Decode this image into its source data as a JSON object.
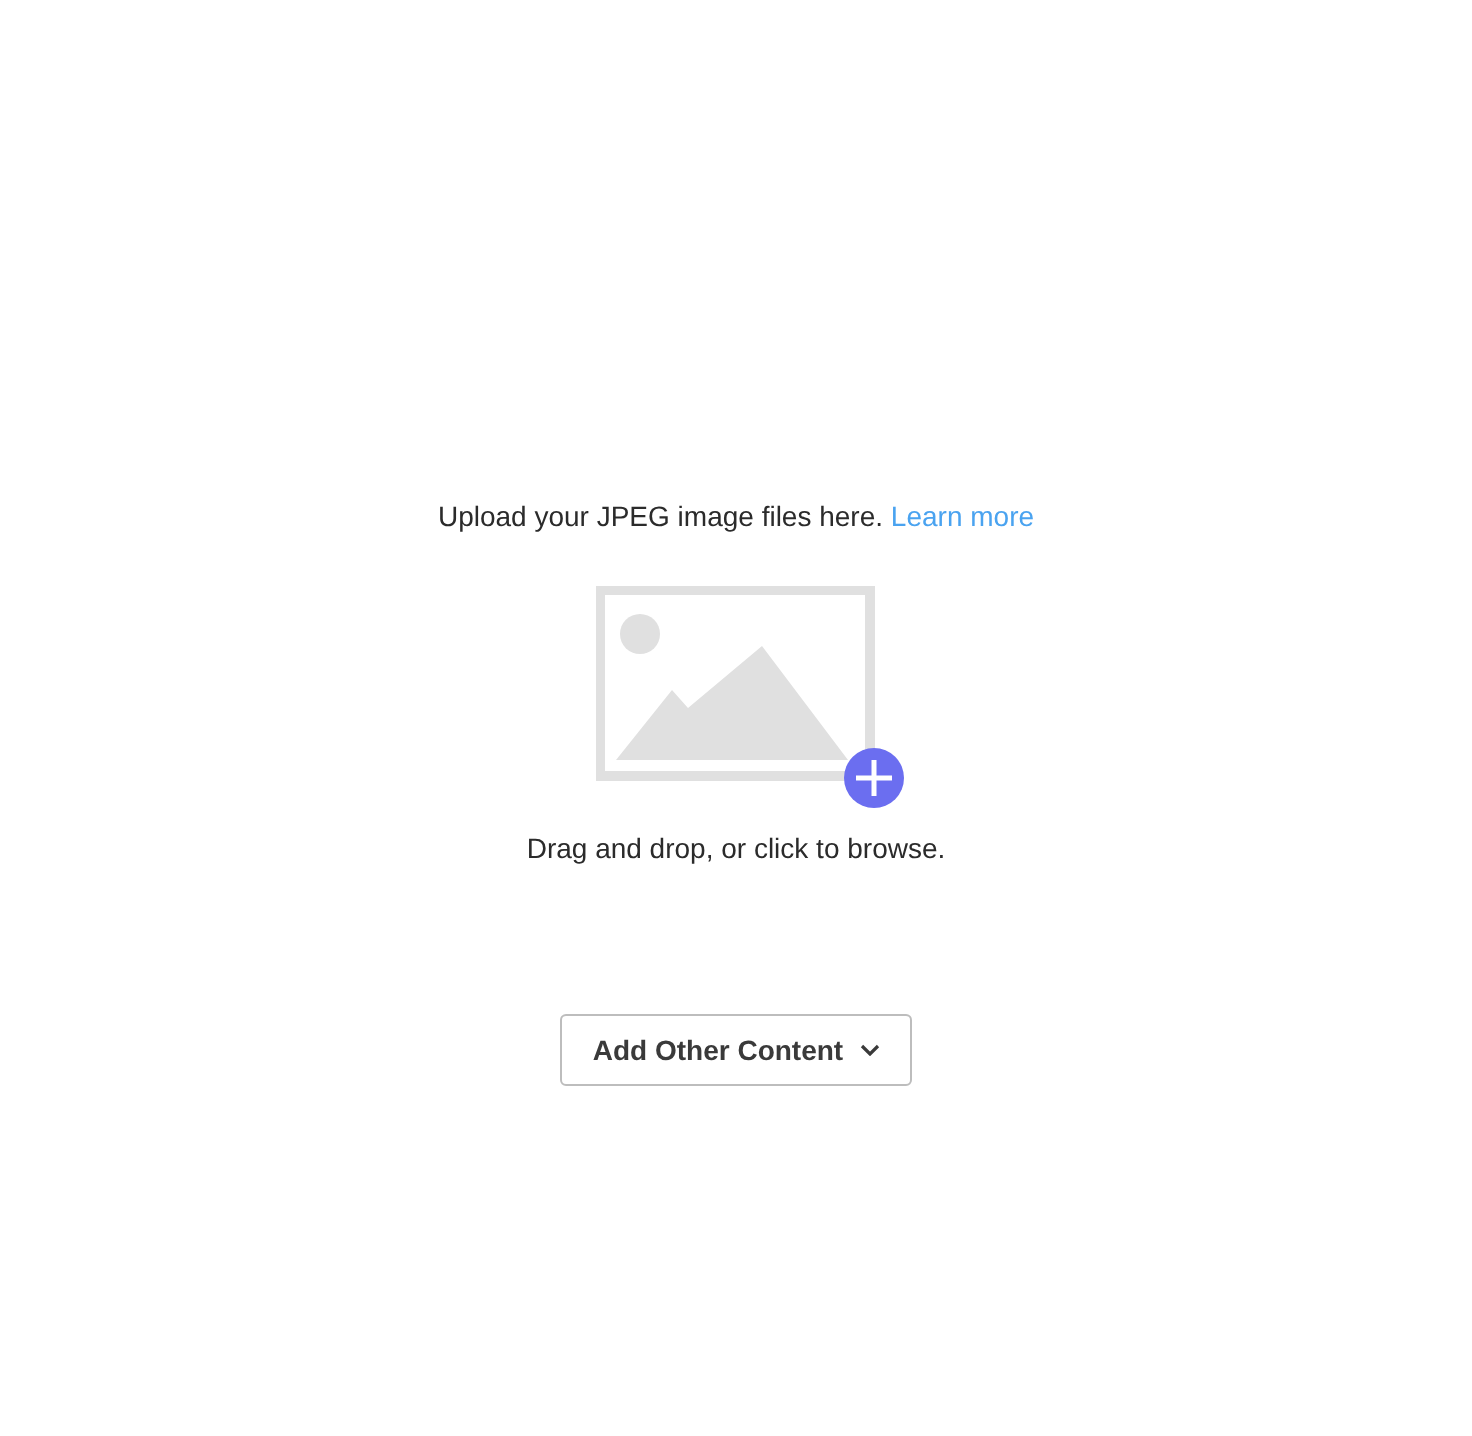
{
  "upload": {
    "intro": "Upload your JPEG image files here.",
    "link": "Learn more",
    "hint": "Drag and drop, or click to browse."
  },
  "add_button": {
    "label": "Add Other Content"
  }
}
